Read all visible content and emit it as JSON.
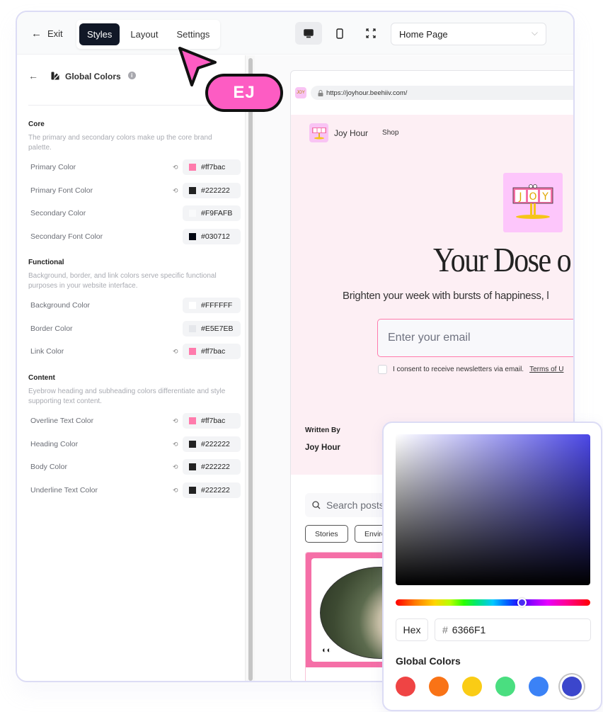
{
  "topbar": {
    "exit_label": "Exit",
    "tabs": [
      {
        "label": "Styles",
        "active": true
      },
      {
        "label": "Layout",
        "active": false
      },
      {
        "label": "Settings",
        "active": false
      }
    ],
    "devices": [
      {
        "icon": "desktop-icon",
        "active": true
      },
      {
        "icon": "mobile-icon",
        "active": false
      },
      {
        "icon": "fullscreen-icon",
        "active": false
      }
    ],
    "page_select": {
      "value": "Home Page"
    }
  },
  "sidebar": {
    "title": "Global Colors",
    "sections": [
      {
        "heading": "Core",
        "description": "The primary and secondary colors make up the core brand palette.",
        "rows": [
          {
            "label": "Primary Color",
            "value": "#ff7bac",
            "swatch": "#ff7bac",
            "reset": true
          },
          {
            "label": "Primary Font Color",
            "value": "#222222",
            "swatch": "#222222",
            "reset": true
          },
          {
            "label": "Secondary Color",
            "value": "#F9FAFB",
            "swatch": "#F9FAFB",
            "reset": false
          },
          {
            "label": "Secondary Font Color",
            "value": "#030712",
            "swatch": "#030712",
            "reset": false
          }
        ]
      },
      {
        "heading": "Functional",
        "description": "Background, border, and link colors serve specific functional purposes in your website interface.",
        "rows": [
          {
            "label": "Background Color",
            "value": "#FFFFFF",
            "swatch": "#FFFFFF",
            "reset": false
          },
          {
            "label": "Border Color",
            "value": "#E5E7EB",
            "swatch": "#E5E7EB",
            "reset": false
          },
          {
            "label": "Link Color",
            "value": "#ff7bac",
            "swatch": "#ff7bac",
            "reset": true
          }
        ]
      },
      {
        "heading": "Content",
        "description": "Eyebrow heading and subheading colors differentiate and style supporting text content.",
        "rows": [
          {
            "label": "Overline Text Color",
            "value": "#ff7bac",
            "swatch": "#ff7bac",
            "reset": true
          },
          {
            "label": "Heading Color",
            "value": "#222222",
            "swatch": "#222222",
            "reset": true
          },
          {
            "label": "Body Color",
            "value": "#222222",
            "swatch": "#222222",
            "reset": true
          },
          {
            "label": "Underline Text Color",
            "value": "#222222",
            "swatch": "#222222",
            "reset": true
          }
        ]
      }
    ]
  },
  "preview": {
    "url": "https://joyhour.beehiiv.com/",
    "site_name": "Joy Hour",
    "nav_link": "Shop",
    "logo_text": "JOY",
    "hero_title": "Your Dose o",
    "hero_subtitle": "Brighten your week with bursts of happiness, l",
    "email_placeholder": "Enter your email",
    "consent_text": "I consent to receive newsletters via email.",
    "consent_link": "Terms of U",
    "written_by_label": "Written By",
    "author": "Joy Hour",
    "search_placeholder": "Search posts",
    "filters": [
      "Stories",
      "Enviro"
    ]
  },
  "collaborator": {
    "initials": "EJ",
    "color": "#fd5cc3"
  },
  "color_picker": {
    "hue_position": 0.65,
    "mode_label": "Hex",
    "hex_value": "6366F1",
    "global_colors_title": "Global Colors",
    "swatches": [
      {
        "color": "#ef4444",
        "selected": false
      },
      {
        "color": "#f97316",
        "selected": false
      },
      {
        "color": "#facc15",
        "selected": false
      },
      {
        "color": "#4ade80",
        "selected": false
      },
      {
        "color": "#3b82f6",
        "selected": false
      },
      {
        "color": "#3b46cc",
        "selected": true
      }
    ]
  }
}
